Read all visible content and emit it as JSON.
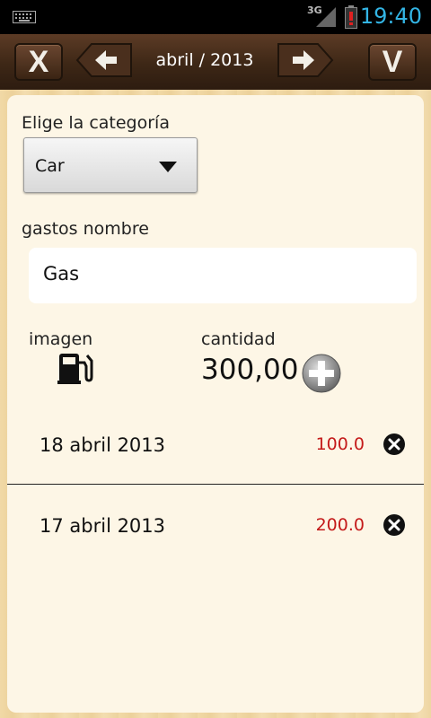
{
  "status_bar": {
    "network": "3G",
    "time": "19:40"
  },
  "toolbar": {
    "close_label": "X",
    "confirm_label": "V",
    "month": "abril / 2013"
  },
  "form": {
    "category_label": "Elige la categoría",
    "category_value": "Car",
    "name_label": "gastos nombre",
    "name_value": "Gas",
    "image_label": "imagen",
    "amount_label": "cantidad",
    "amount_value": "300,00"
  },
  "entries": [
    {
      "date": "18 abril 2013",
      "amount": "100.0"
    },
    {
      "date": "17 abril 2013",
      "amount": "200.0"
    }
  ],
  "colors": {
    "accent": "#33b5e5",
    "amount_red": "#c41a1a"
  },
  "icons": [
    "keyboard-icon",
    "signal-icon",
    "battery-icon",
    "prev-arrow-icon",
    "next-arrow-icon",
    "dropdown-caret-icon",
    "gas-pump-icon",
    "add-icon",
    "delete-icon"
  ]
}
